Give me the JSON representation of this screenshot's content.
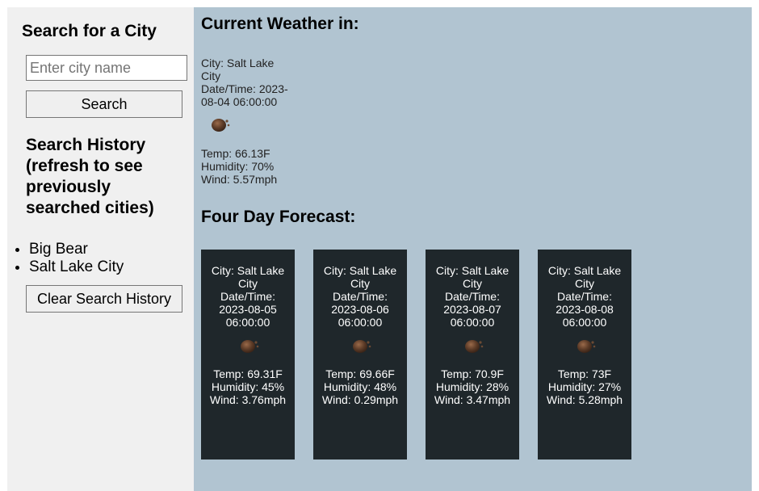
{
  "sidebar": {
    "title": "Search for a City",
    "search_placeholder": "Enter city name",
    "search_value": "",
    "search_button": "Search",
    "history_heading": "Search History (refresh to see previously searched cities)",
    "history": [
      "Big Bear",
      "Salt Lake City"
    ],
    "clear_button": "Clear Search History"
  },
  "current": {
    "heading": "Current Weather in:",
    "city": "City: Salt Lake City",
    "datetime": "Date/Time: 2023-08-04 06:00:00",
    "icon": "weather-icon",
    "temp": "Temp: 66.13F",
    "humidity": "Humidity: 70%",
    "wind": "Wind: 5.57mph"
  },
  "forecast": {
    "heading": "Four Day Forecast:",
    "days": [
      {
        "city": "City: Salt Lake City",
        "datetime": "Date/Time: 2023-08-05 06:00:00",
        "temp": "Temp: 69.31F",
        "humidity": "Humidity: 45%",
        "wind": "Wind: 3.76mph"
      },
      {
        "city": "City: Salt Lake City",
        "datetime": "Date/Time: 2023-08-06 06:00:00",
        "temp": "Temp: 69.66F",
        "humidity": "Humidity: 48%",
        "wind": "Wind: 0.29mph"
      },
      {
        "city": "City: Salt Lake City",
        "datetime": "Date/Time: 2023-08-07 06:00:00",
        "temp": "Temp: 70.9F",
        "humidity": "Humidity: 28%",
        "wind": "Wind: 3.47mph"
      },
      {
        "city": "City: Salt Lake City",
        "datetime": "Date/Time: 2023-08-08 06:00:00",
        "temp": "Temp: 73F",
        "humidity": "Humidity: 27%",
        "wind": "Wind: 5.28mph"
      }
    ]
  },
  "colors": {
    "sidebar_bg": "#f0f0f0",
    "main_bg": "#b1c4d1",
    "card_bg": "#1f272b"
  }
}
